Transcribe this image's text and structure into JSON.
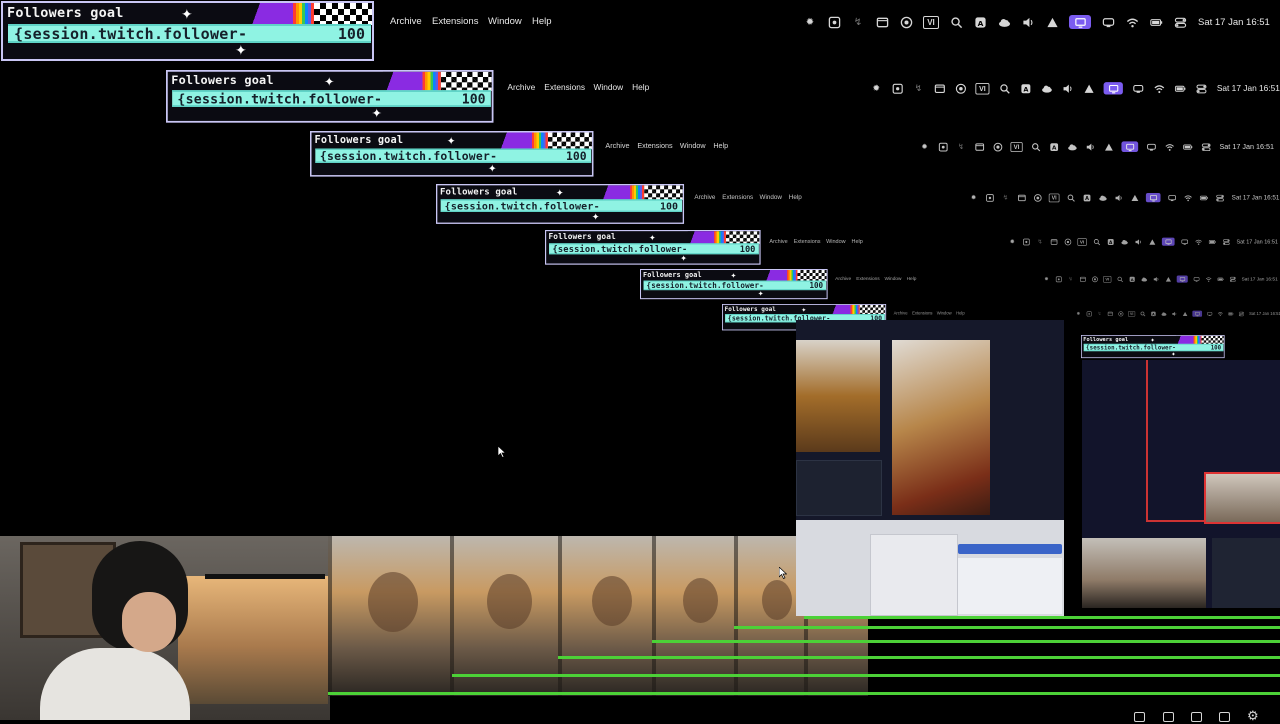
{
  "widget": {
    "title": "Followers goal",
    "bar_text": "{session.twitch.follower-",
    "goal": "100"
  },
  "menu": {
    "items": [
      "Archive",
      "Extensions",
      "Window",
      "Help"
    ]
  },
  "status": {
    "icons": [
      "brightness-icon",
      "screen-record-icon",
      "sync-icon",
      "window-icon",
      "play-circle-icon",
      "vi-icon",
      "search-icon",
      "app-a-icon",
      "cloud-icon",
      "volume-icon",
      "airplay-icon",
      "display-icon",
      "gamepad-icon",
      "wifi-icon",
      "battery-icon",
      "control-center-icon"
    ],
    "vi_label": "VI",
    "clock": "Sat 17 Jan  16:51"
  },
  "colors": {
    "accent": "#7b5cf0",
    "bar": "#8ff3e3",
    "purple": "#8a2be2",
    "green": "#4cd137"
  }
}
